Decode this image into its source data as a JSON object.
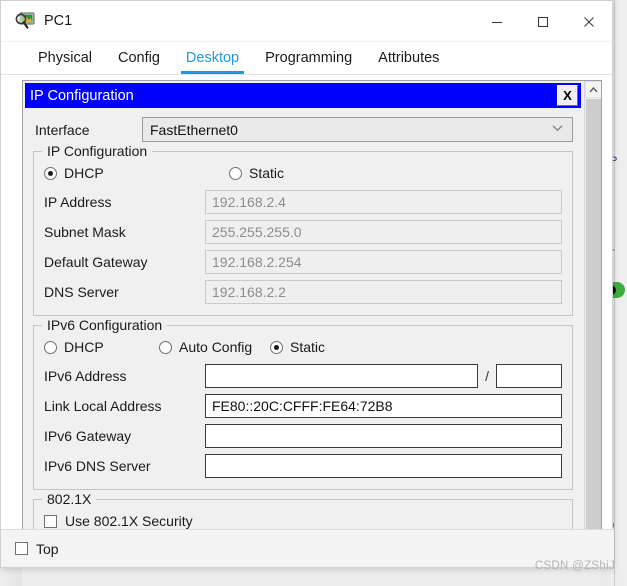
{
  "window": {
    "title": "PC1",
    "icon": "pc-magnifier-icon",
    "minimize_label": "—",
    "maximize_label": "☐",
    "close_label": "✕"
  },
  "tabs": [
    {
      "label": "Physical",
      "active": false
    },
    {
      "label": "Config",
      "active": false
    },
    {
      "label": "Desktop",
      "active": true
    },
    {
      "label": "Programming",
      "active": false
    },
    {
      "label": "Attributes",
      "active": false
    }
  ],
  "ip_window": {
    "title": "IP Configuration",
    "close_label": "X",
    "interface": {
      "label": "Interface",
      "value": "FastEthernet0",
      "arrow": "chevron-down-icon"
    },
    "ipv4": {
      "group_title": "IP Configuration",
      "modes": [
        {
          "label": "DHCP",
          "selected": true
        },
        {
          "label": "Static",
          "selected": false
        }
      ],
      "fields": [
        {
          "label": "IP Address",
          "value": "192.168.2.4",
          "enabled": false
        },
        {
          "label": "Subnet Mask",
          "value": "255.255.255.0",
          "enabled": false
        },
        {
          "label": "Default Gateway",
          "value": "192.168.2.254",
          "enabled": false
        },
        {
          "label": "DNS Server",
          "value": "192.168.2.2",
          "enabled": false
        }
      ]
    },
    "ipv6": {
      "group_title": "IPv6 Configuration",
      "modes": [
        {
          "label": "DHCP",
          "selected": false
        },
        {
          "label": "Auto Config",
          "selected": false
        },
        {
          "label": "Static",
          "selected": true
        }
      ],
      "address": {
        "label": "IPv6 Address",
        "value": "",
        "separator": "/",
        "prefix_value": ""
      },
      "fields": [
        {
          "label": "Link Local Address",
          "value": "FE80::20C:CFFF:FE64:72B8",
          "enabled": true
        },
        {
          "label": "IPv6 Gateway",
          "value": "",
          "enabled": true
        },
        {
          "label": "IPv6 DNS Server",
          "value": "",
          "enabled": true
        }
      ]
    },
    "dot1x": {
      "group_title": "802.1X",
      "checkbox_label": "Use 802.1X Security",
      "checked": false
    }
  },
  "scrollbar": {
    "up_label": "∧",
    "down_label": "∨"
  },
  "bottom": {
    "top_checkbox_label": "Top",
    "top_checked": false
  },
  "watermark": "CSDN @ZShiJ",
  "colors": {
    "accent": "#1b9bd8",
    "titlebar_blue": "#0000ff",
    "disabled_text": "#8d8d8d"
  }
}
